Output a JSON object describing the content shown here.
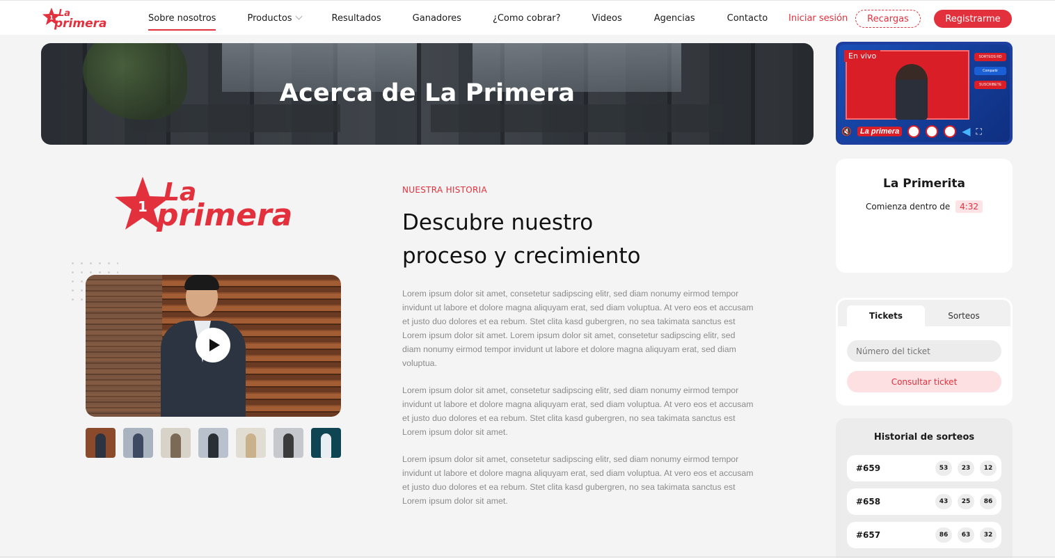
{
  "header": {
    "logo": {
      "line1": "La",
      "line2": "primera",
      "star_number": "1"
    },
    "nav": [
      {
        "label": "Sobre nosotros",
        "active": true
      },
      {
        "label": "Productos",
        "dropdown": true
      },
      {
        "label": "Resultados"
      },
      {
        "label": "Ganadores"
      },
      {
        "label": "¿Como cobrar?"
      },
      {
        "label": "Videos"
      },
      {
        "label": "Agencias"
      },
      {
        "label": "Contacto"
      }
    ],
    "login_label": "Iniciar sesión",
    "recargas_label": "Recargas",
    "register_label": "Registrarme"
  },
  "banner": {
    "title": "Acerca de La Primera"
  },
  "live": {
    "badge": "En vivo",
    "brand": "La primera",
    "side_labels": [
      "SORTEOS RD",
      "Compartir",
      "SUSCRIBETE"
    ]
  },
  "primerita": {
    "title": "La Primerita",
    "subtitle": "Comienza dentro de",
    "countdown": "4:32"
  },
  "tickets": {
    "tabs": [
      "Tickets",
      "Sorteos"
    ],
    "input_placeholder": "Número del ticket",
    "button_label": "Consultar ticket"
  },
  "historial": {
    "title": "Historial de sorteos",
    "draws": [
      {
        "id": "#659",
        "numbers": [
          "53",
          "23",
          "12"
        ]
      },
      {
        "id": "#658",
        "numbers": [
          "43",
          "25",
          "86"
        ]
      },
      {
        "id": "#657",
        "numbers": [
          "86",
          "63",
          "32"
        ]
      }
    ]
  },
  "content": {
    "eyebrow": "NUESTRA HISTORIA",
    "headline_line1": "Descubre nuestro",
    "headline_line2": "proceso y crecimiento",
    "paragraphs": [
      "Lorem ipsum dolor sit amet, consetetur sadipscing elitr, sed diam nonumy eirmod tempor invidunt ut labore et dolore magna aliquyam erat, sed diam voluptua. At vero eos et accusam et justo duo dolores et ea rebum. Stet clita kasd gubergren, no sea takimata sanctus est Lorem ipsum dolor sit amet. Lorem ipsum dolor sit amet, consetetur sadipscing elitr, sed diam nonumy eirmod tempor invidunt ut labore et dolore magna aliquyam erat, sed diam voluptua.",
      "Lorem ipsum dolor sit amet, consetetur sadipscing elitr, sed diam nonumy eirmod tempor invidunt ut labore et dolore magna aliquyam erat, sed diam voluptua. At vero eos et accusam et justo duo dolores et ea rebum. Stet clita kasd gubergren, no sea takimata sanctus est Lorem ipsum dolor sit amet.",
      "Lorem ipsum dolor sit amet, consetetur sadipscing elitr, sed diam nonumy eirmod tempor invidunt ut labore et dolore magna aliquyam erat, sed diam voluptua. At vero eos et accusam et justo duo dolores et ea rebum. Stet clita kasd gubergren, no sea takimata sanctus est Lorem ipsum dolor sit amet."
    ]
  },
  "colors": {
    "brand_red": "#e3303d",
    "live_blue": "#1c3fa0"
  }
}
